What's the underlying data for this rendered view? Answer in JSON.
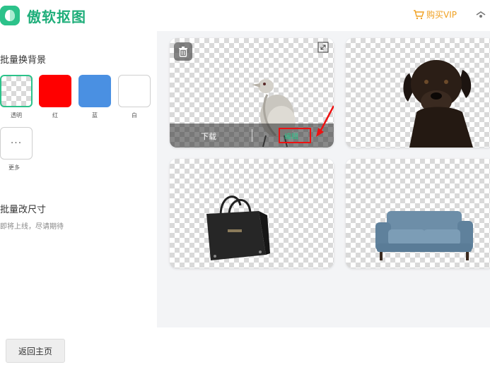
{
  "app": {
    "title": "傲软抠图",
    "vip_label": "购买VIP"
  },
  "sidebar": {
    "batch_bg_title": "批量换背景",
    "swatches": [
      {
        "label": "透明",
        "color": "transparent"
      },
      {
        "label": "红",
        "color": "#ff0000"
      },
      {
        "label": "蓝",
        "color": "#4a90e2"
      },
      {
        "label": "白",
        "color": "#ffffff"
      }
    ],
    "more_label": "更多",
    "more_glyph": "···",
    "batch_resize_title": "批量改尺寸",
    "coming_soon": "即将上线，尽请期待"
  },
  "gallery": {
    "cards": [
      {
        "subject": "bird",
        "has_actions": true
      },
      {
        "subject": "dog"
      },
      {
        "subject": "handbag"
      },
      {
        "subject": "sofa"
      }
    ],
    "download_label": "下载",
    "edit_label": "编辑"
  },
  "footer": {
    "home_label": "返回主页"
  },
  "colors": {
    "brand": "#2cc28a",
    "vip": "#f0a020",
    "highlight": "#ee1111"
  }
}
